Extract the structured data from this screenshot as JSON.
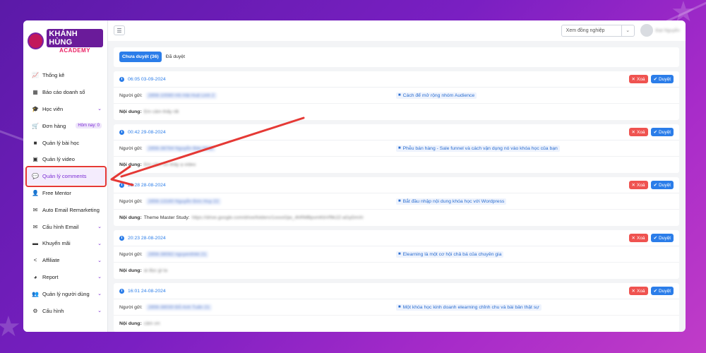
{
  "brand": {
    "line1": "KHÁNH HÙNG",
    "line2": "ACADEMY"
  },
  "sidebar": {
    "items": [
      {
        "label": "Thống kê",
        "icon": "chart-icon",
        "chevron": false
      },
      {
        "label": "Báo cáo doanh số",
        "icon": "report-icon",
        "chevron": false
      },
      {
        "label": "Học viên",
        "icon": "student-icon",
        "chevron": true
      },
      {
        "label": "Đơn hàng",
        "icon": "cart-icon",
        "chevron": false,
        "badge": "Hôm nay: 0"
      },
      {
        "label": "Quản lý bài học",
        "icon": "video-camera-icon",
        "chevron": false
      },
      {
        "label": "Quản lý video",
        "icon": "film-icon",
        "chevron": false
      },
      {
        "label": "Quản lý comments",
        "icon": "comments-icon",
        "chevron": false,
        "active": true
      },
      {
        "label": "Free Mentor",
        "icon": "user-icon",
        "chevron": false
      },
      {
        "label": "Auto Email Remarketing",
        "icon": "email-auto-icon",
        "chevron": false
      },
      {
        "label": "Cấu hình Email",
        "icon": "envelope-icon",
        "chevron": true
      },
      {
        "label": "Khuyến mãi",
        "icon": "ticket-icon",
        "chevron": true
      },
      {
        "label": "Affiliate",
        "icon": "share-icon",
        "chevron": true
      },
      {
        "label": "Report",
        "icon": "pie-chart-icon",
        "chevron": true
      },
      {
        "label": "Quản lý người dùng",
        "icon": "users-icon",
        "chevron": true
      },
      {
        "label": "Cấu hình",
        "icon": "gear-icon",
        "chevron": true
      }
    ]
  },
  "topbar": {
    "select_placeholder": "Xem đồng nghiệp",
    "user_name": "Đạt Nguyễn"
  },
  "tabs": [
    {
      "label": "Chưa duyệt (36)",
      "active": true
    },
    {
      "label": "Đã duyệt",
      "active": false
    }
  ],
  "labels": {
    "sender": "Người gửi:",
    "content": "Nội dung:",
    "delete": "Xoá",
    "approve": "Duyệt"
  },
  "comments": [
    {
      "time": "06:05 03-09-2024",
      "sender": "2856-10080 Hồ Hải Huệ Linh 2",
      "lesson": "Cách để mở rộng nhóm Audience",
      "content": "Em cảm thấy rất",
      "content_blurred": true
    },
    {
      "time": "00:42 29-08-2024",
      "sender": "2856-38784 Nguyễn Bảo Nhật",
      "lesson": "Phễu bán hàng - Sale funnel và cách vận dụng nó vào khóa học của bạn",
      "content": "Em cảm ơn thầy ạ video",
      "content_blurred": true
    },
    {
      "time": "23:28 28-08-2024",
      "sender": "2856-13160 Nguyễn Đức Huy 22",
      "lesson": "Bắt đầu nhập nội dung khóa học với Wordpress",
      "content": "Theme Master Study:",
      "content_extra": "https://drive.google.com/drive/folders/1xxxxGjw_4hRMBpvmKbVf9k2Z-aGyDmXr",
      "content_blurred": false
    },
    {
      "time": "20:23 28-08-2024",
      "sender": "2856-38082 nguyenthikt 21",
      "lesson": "Elearning là một cơ hội chả bá của chuyên gia",
      "content": "ai đọc gì ta",
      "content_blurred": true
    },
    {
      "time": "16:01 24-08-2024",
      "sender": "2856-38030 Đỗ Anh Tuấn 21",
      "lesson": "Một khóa học kinh doanh elearning chỉnh chu và bài bản thật sự",
      "content": "cảm ơn",
      "content_blurred": true
    }
  ],
  "colors": {
    "accent": "#7b2bd4",
    "primary": "#2b7de9",
    "danger": "#ef5350",
    "annotation": "#e53935"
  }
}
